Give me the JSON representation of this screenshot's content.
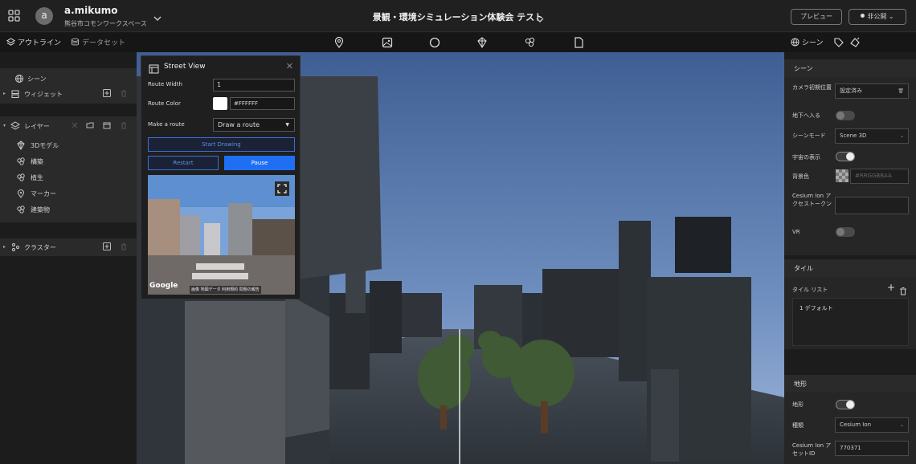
{
  "header": {
    "user_initial": "a",
    "user_name": "a.mikumo",
    "workspace": "熊谷市コモンワークスペース",
    "project_title": "景観・環境シミュレーション体験会 テスト",
    "preview_label": "プレビュー",
    "publish_label": "非公開"
  },
  "left_tabs": {
    "outline": "アウトライン",
    "dataset": "データセット"
  },
  "right_tabs": {
    "scene": "シーン"
  },
  "outline": {
    "scene": "シーン",
    "widget": "ウィジェット",
    "layers": "レイヤー",
    "layer_items": [
      "3Dモデル",
      "構築",
      "植生",
      "マーカー",
      "建築物"
    ],
    "cluster": "クラスター"
  },
  "street_view": {
    "title": "Street View",
    "route_width_label": "Route Width",
    "route_width_value": "1",
    "route_color_label": "Route Color",
    "route_color_value": "#FFFFFF",
    "make_route_label": "Make a route",
    "make_route_value": "Draw a route",
    "start_drawing": "Start Drawing",
    "restart": "Restart",
    "pause": "Pause",
    "google": "Google",
    "attribution": "画像  地図データ  利用規約  問題の報告"
  },
  "scene_panel": {
    "section_title": "シーン",
    "camera_label": "カメラ初期位置",
    "camera_value": "設定済み",
    "underground_label": "地下へ入る",
    "underground_on": false,
    "scene_mode_label": "シーンモード",
    "scene_mode_value": "Scene 3D",
    "sky_label": "宇宙の表示",
    "sky_on": true,
    "bg_label": "背景色",
    "bg_value": "#RRGGBBAA",
    "cesium_token_label": "Cesium Ion アクセストークン",
    "cesium_token_value": "",
    "vr_label": "VR",
    "vr_on": false
  },
  "tile_panel": {
    "section_title": "タイル",
    "list_label": "タイル リスト",
    "items": [
      "1 デフォルト"
    ]
  },
  "terrain_panel": {
    "section_title": "地形",
    "terrain_label": "地形",
    "terrain_on": true,
    "type_label": "種類",
    "type_value": "Cesium Ion",
    "asset_label": "Cesium Ion アセットID",
    "asset_value": "770371"
  },
  "colors": {
    "accent": "#1e6ff3",
    "panel": "#262626",
    "background": "#1a1a1a"
  }
}
